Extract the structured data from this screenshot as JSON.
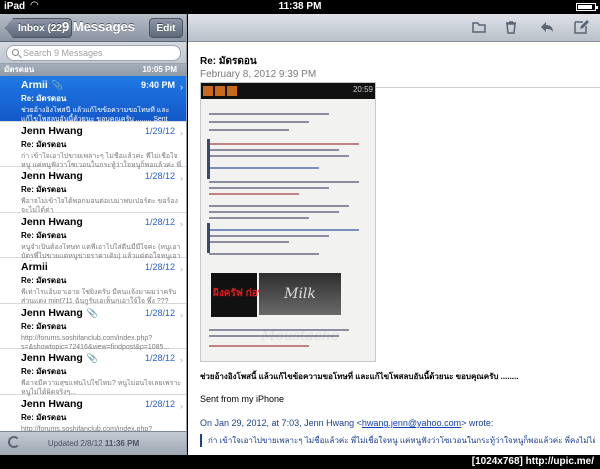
{
  "status": {
    "device": "iPad",
    "time": "11:38 PM",
    "battery_level": 0.9
  },
  "sidebar": {
    "back_label": "Inbox (22)",
    "title": "9 Messages",
    "edit_label": "Edit",
    "search_placeholder": "Search 9 Messages",
    "section": {
      "label": "มัดรดอน",
      "time": "10:05 PM"
    },
    "messages": [
      {
        "from": "Armii",
        "date": "9:40 PM",
        "subject": "Re: มัดรดอน",
        "preview": "ช่วยอ้างอิงโพสนี้ แล้วแก้ไขข้อความขอโทษที่ และแก้ไขโพสลบอันนี้ด้วยนะ ขอบคุณครับ ........ Sent from my iPhon...",
        "attachment": true,
        "selected": true
      },
      {
        "from": "Jenn Hwang",
        "date": "1/29/12",
        "subject": "Re: มัดรดอน",
        "preview": "ก่า เข้าใจเอาไปขายเพลาะๆ ไม่ชื่อแล้วค่ะ พี่ไม่เชื่อใจหนู แค่หนูฟังว่าโซเวอนในกระทู้ว่าใจหนูก็พอแล้วค่ะ พี่คงไม่ได้เข้าไป...",
        "attachment": false,
        "selected": false
      },
      {
        "from": "Jenn Hwang",
        "date": "1/28/12",
        "subject": "Re: มัดรดอน",
        "preview": "พี่อาจไม่เข้าใจได้พอกมอนต่อเบมาพบเปอร์ตะ ขอร้อง จะไม่ได้ด่า",
        "attachment": false,
        "selected": false
      },
      {
        "from": "Jenn Hwang",
        "date": "1/28/12",
        "subject": "Re: มัดรดอน",
        "preview": "หนูจำเป็นต้องโทษท แต่พี่เอาไปใส่ดีนมีมีใจค่ะ (หนูเอาบัตรพี่ไปขายแต่หนูขายราคาเดิม) แล้วแต่ต่อใจหนูเอาไปใ...",
        "attachment": false,
        "selected": false
      },
      {
        "from": "Armii",
        "date": "1/28/12",
        "subject": "Re: มัดรดอน",
        "preview": "พี่เท่าไรแอ้บอาเอาย ใช่ยิงครับ มีคนแจ้งมาผมว่าครับ ส่วนแดง mint711 ฉันกูรับเอเห็นกเอาใจ้ใจ พึ่ง ??? อีก...",
        "attachment": false,
        "selected": false
      },
      {
        "from": "Jenn Hwang",
        "date": "1/28/12",
        "subject": "Re: มัดรดอน",
        "preview": "http://forums.soshifanclub.com/index.php?s=&showtopic=72416&view=findpost&p=1085...",
        "attachment": true,
        "selected": false
      },
      {
        "from": "Jenn Hwang",
        "date": "1/28/12",
        "subject": "Re: มัดรดอน",
        "preview": "พี่อาจมีความสุขแฟนไปใช่ไหม? หนูไม่อนไจเลยเพราะหนูไม่ได้ผิดจริงๆ...",
        "attachment": true,
        "selected": false
      },
      {
        "from": "Jenn Hwang",
        "date": "1/28/12",
        "subject": "Re: มัดรดอน",
        "preview": "http://forums.soshifanclub.com/index.php?",
        "attachment": false,
        "selected": false
      }
    ],
    "footer": {
      "updated_label": "Updated",
      "updated_date": "2/8/12",
      "updated_time": "11:36 PM"
    }
  },
  "message": {
    "subject": "Re: มัดรดอน",
    "date": "February 8, 2012 9:39 PM",
    "screenshot": {
      "clock": "20:59",
      "shirt_text": "ผิงครัฟ ก่อนตาน",
      "banner_text": "Milk Moustache"
    },
    "body_thai": "ช่วยอ้างอิงโพสนี้ แล้วแก้ไขข้อความขอโทษที่ และแก้ไขโพสลบอันนี้ด้วยนะ ขอบคุณครับ ........",
    "signature": "Sent from my iPhone",
    "quote_intro_pre": "On Jan 29, 2012, at 7:03, Jenn Hwang <",
    "quote_email": "hwang.jenn@yahoo.com",
    "quote_intro_post": "> wrote:",
    "quote_text": "ก่า เข้าใจเอาไปขายเพลาะๆ ไม่ชื่อแล้วค่ะ พี่ไม่เชื่อใจหนู แค่หนูฟังว่าโซเวอนในกระทู้ว่าใจหนูก็พอแล้วค่ะ พี่คงไม่ได้เข้าไป"
  },
  "watermark": "[1024x768] http://upic.me/",
  "colors": {
    "selected": "#1e7ae6",
    "date_blue": "#2a62c9",
    "link": "#1240b8"
  }
}
